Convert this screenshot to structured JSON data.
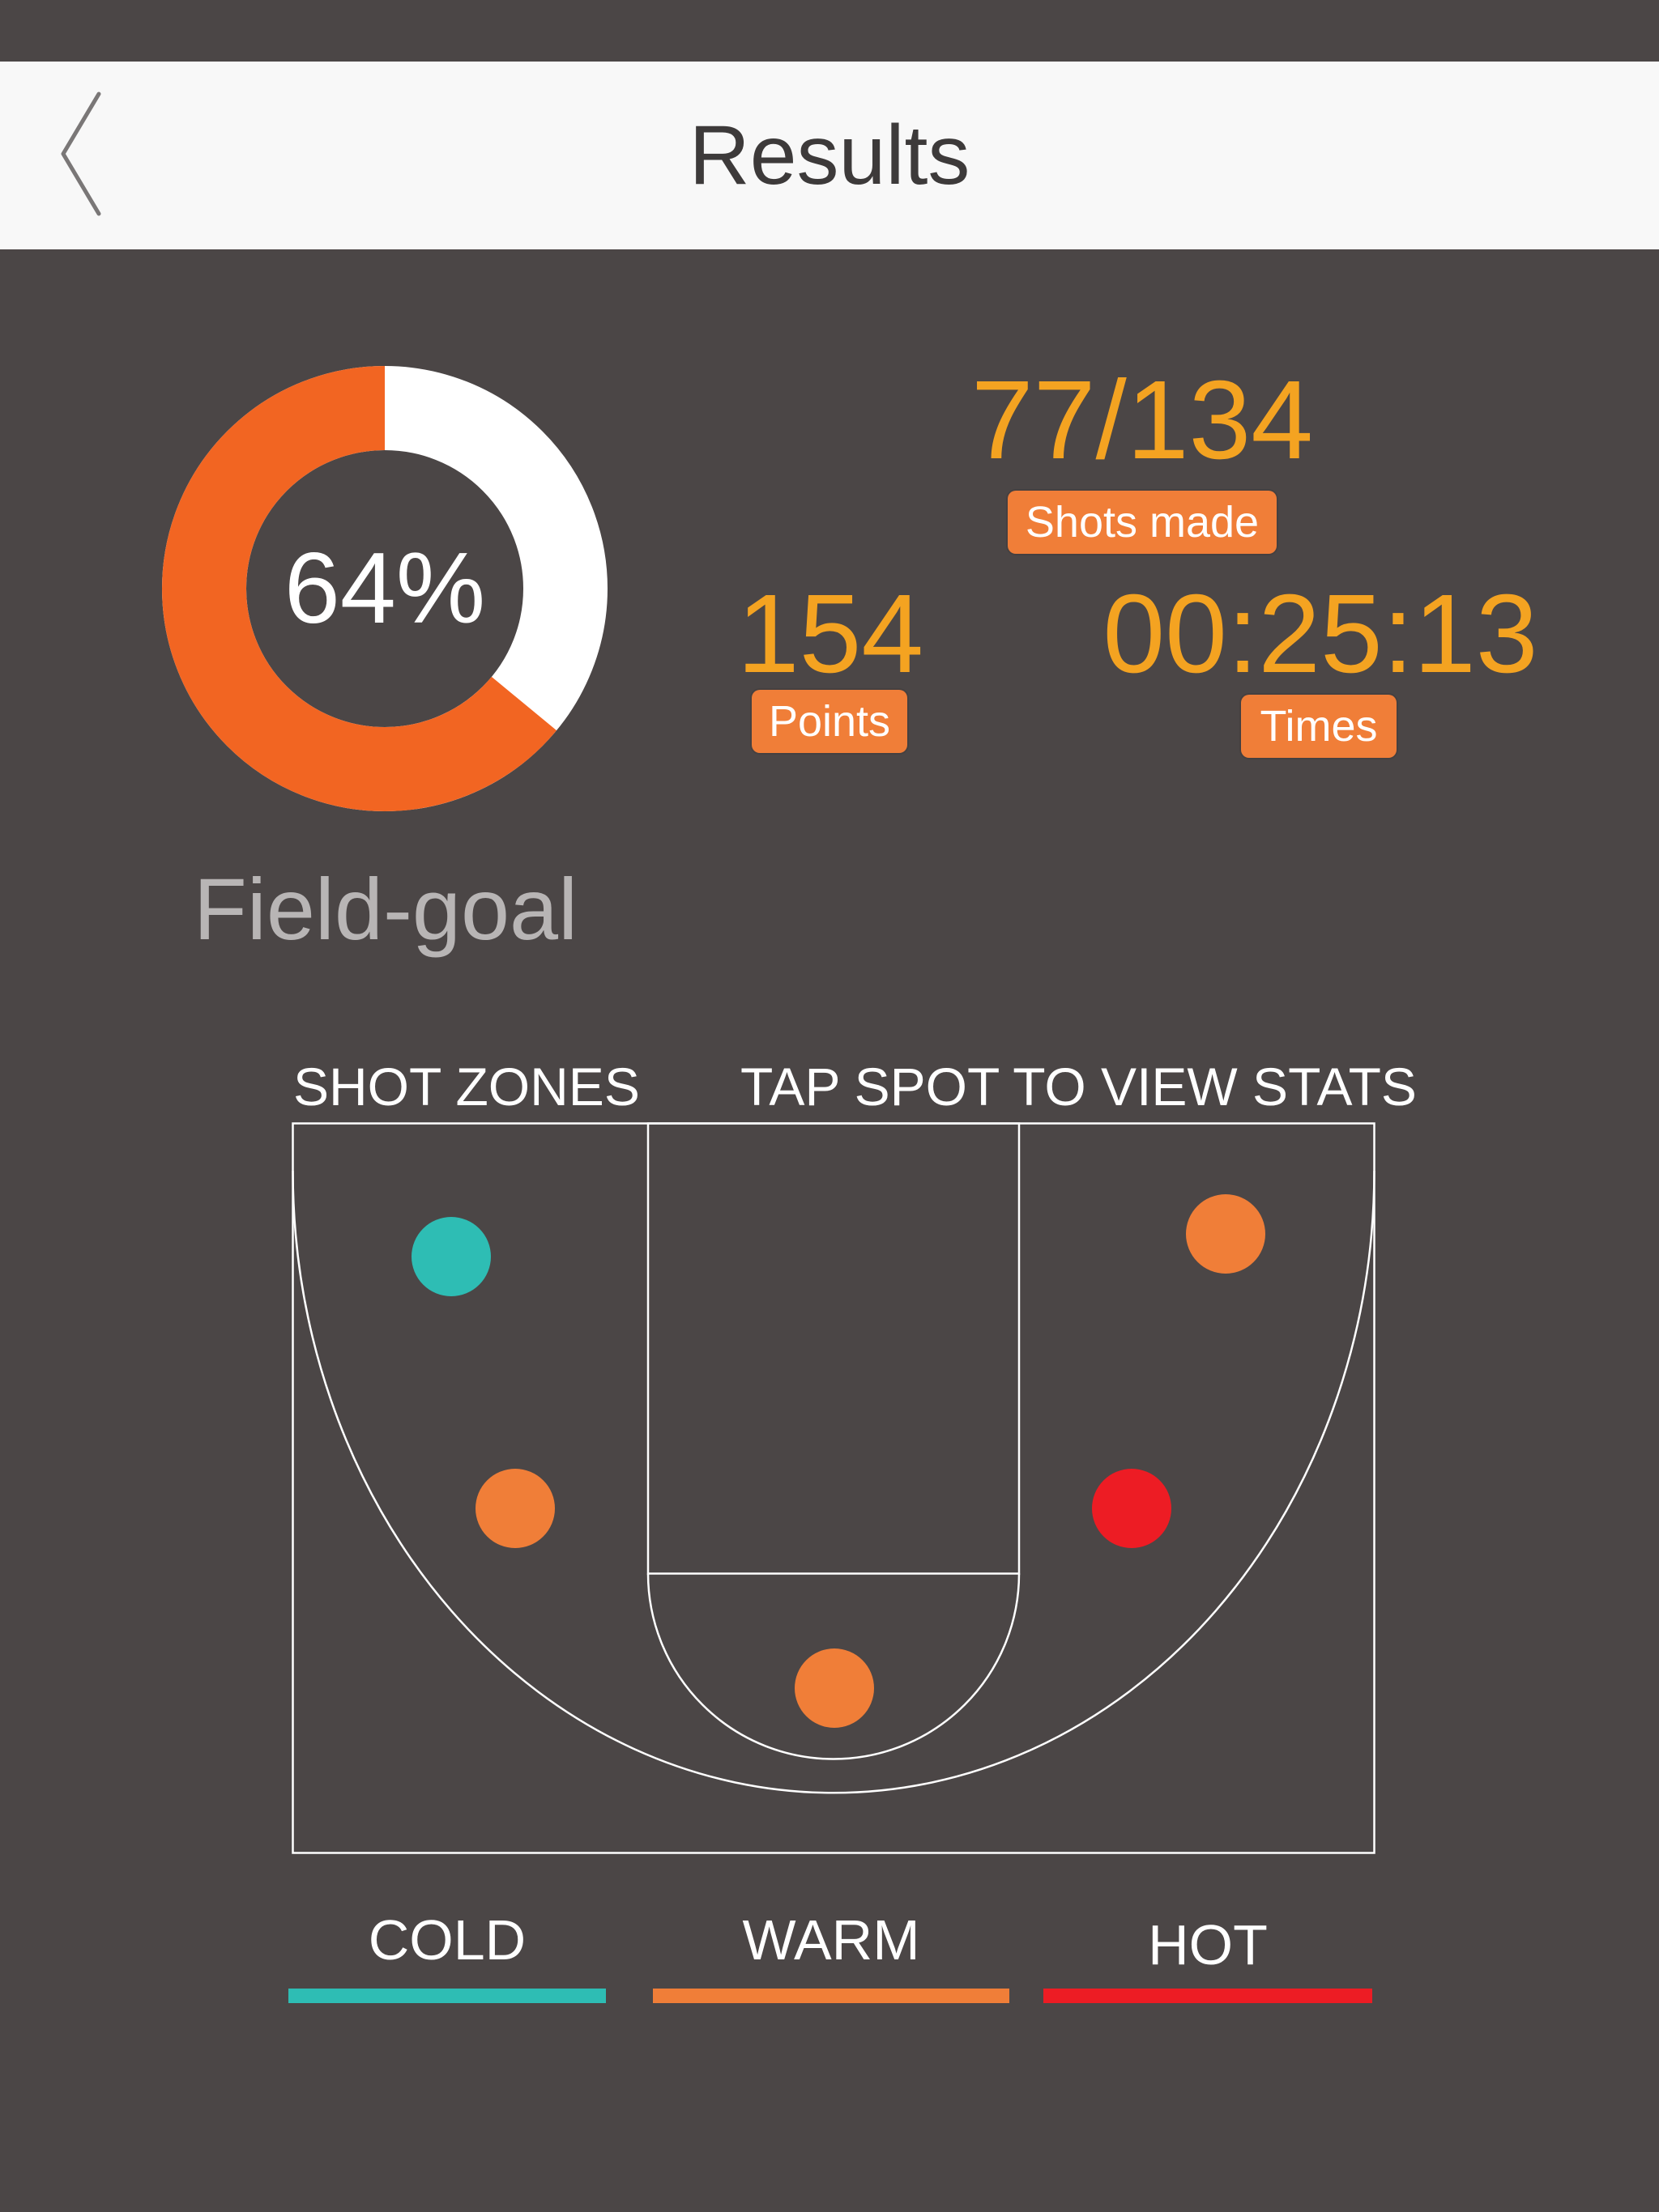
{
  "header": {
    "title": "Results",
    "back_icon": "chevron-left-icon"
  },
  "field_goal": {
    "percent_label": "64%",
    "percent_value": 64,
    "caption": "Field-goal",
    "made_color": "#f26522",
    "missed_color": "#ffffff"
  },
  "stats": {
    "shots_made": {
      "value": "77/134",
      "label": "Shots made"
    },
    "points": {
      "value": "154",
      "label": "Points"
    },
    "time": {
      "value": "00:25:13",
      "label": "Times"
    },
    "value_color": "#f4a321",
    "pill_color": "#f07e38"
  },
  "court": {
    "title": "SHOT ZONES",
    "hint": "TAP SPOT TO VIEW STATS",
    "spots": [
      {
        "zone": "left-corner",
        "heat": "cold"
      },
      {
        "zone": "right-corner",
        "heat": "warm"
      },
      {
        "zone": "left-wing",
        "heat": "warm"
      },
      {
        "zone": "right-wing",
        "heat": "hot"
      },
      {
        "zone": "top-key",
        "heat": "warm"
      }
    ]
  },
  "legend": [
    {
      "key": "cold",
      "label": "COLD",
      "color": "#2ebdb4"
    },
    {
      "key": "warm",
      "label": "WARM",
      "color": "#f07e38"
    },
    {
      "key": "hot",
      "label": "HOT",
      "color": "#ed1c24"
    }
  ]
}
